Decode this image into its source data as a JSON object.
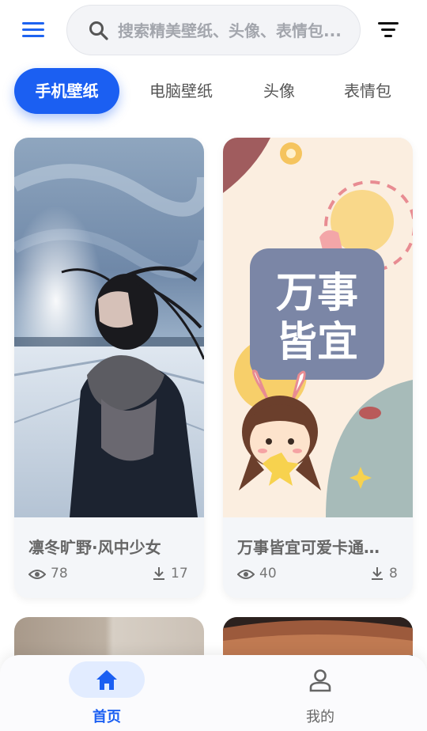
{
  "header": {
    "menu_icon": "menu-icon",
    "search": {
      "placeholder": "搜索精美壁纸、头像、表情包...",
      "icon": "search-icon"
    },
    "filter_icon": "filter-icon"
  },
  "tabs": [
    {
      "label": "手机壁纸",
      "active": true
    },
    {
      "label": "电脑壁纸",
      "active": false
    },
    {
      "label": "头像",
      "active": false
    },
    {
      "label": "表情包",
      "active": false
    }
  ],
  "cards": [
    {
      "title": "凛冬旷野·风中少女",
      "views": "78",
      "downloads": "17"
    },
    {
      "title": "万事皆宜可爱卡通…",
      "views": "40",
      "downloads": "8",
      "art_text": [
        "万事",
        "皆宜"
      ]
    }
  ],
  "bottom_nav": [
    {
      "label": "首页",
      "icon": "home-icon",
      "active": true
    },
    {
      "label": "我的",
      "icon": "user-icon",
      "active": false
    }
  ],
  "colors": {
    "accent": "#1b5ff2",
    "active_pill": "#e2ecff",
    "card_bg": "#f4f6f9"
  }
}
